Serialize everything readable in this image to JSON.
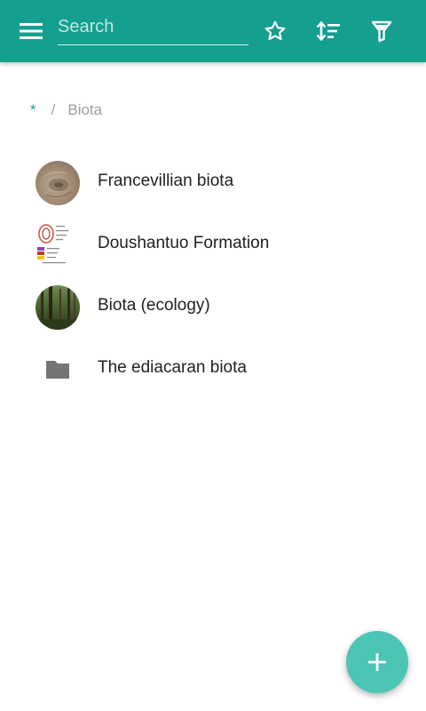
{
  "topbar": {
    "menu_icon": "menu-icon",
    "search": {
      "placeholder": "Search",
      "value": ""
    },
    "actions": [
      {
        "name": "favorites",
        "icon": "star-outline-icon"
      },
      {
        "name": "sort",
        "icon": "sort-icon"
      },
      {
        "name": "filter",
        "icon": "filter-icon"
      }
    ]
  },
  "breadcrumb": {
    "root": "*",
    "separator": "/",
    "current": "Biota"
  },
  "list": {
    "items": [
      {
        "label": "Francevillian biota",
        "thumb": "fossil-thumbnail"
      },
      {
        "label": "Doushantuo Formation",
        "thumb": "diagram-thumbnail"
      },
      {
        "label": "Biota (ecology)",
        "thumb": "forest-thumbnail"
      },
      {
        "label": "The ediacaran biota",
        "thumb": "folder-icon"
      }
    ]
  },
  "fab": {
    "icon": "add-icon"
  },
  "colors": {
    "primary": "#149f8f",
    "accent": "#4dc5b5",
    "text": "#212121",
    "muted": "#9e9e9e",
    "folder": "#757575"
  }
}
